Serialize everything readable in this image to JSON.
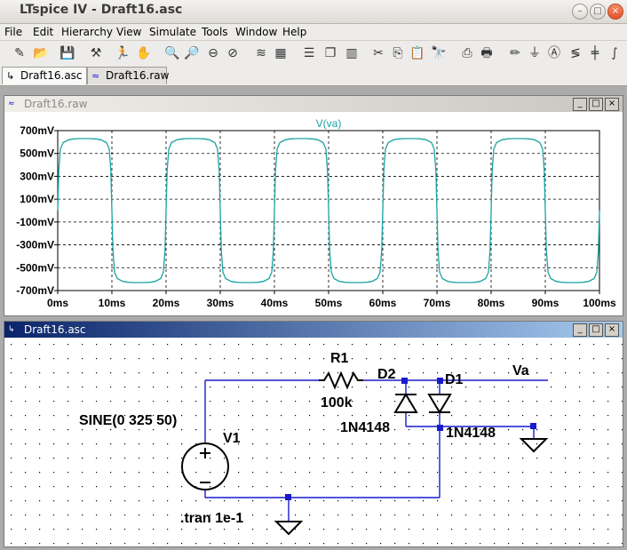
{
  "app": {
    "title": "LTspice IV - Draft16.asc",
    "window_buttons": [
      "–",
      "□",
      "×"
    ]
  },
  "menu": [
    "File",
    "Edit",
    "Hierarchy",
    "View",
    "Simulate",
    "Tools",
    "Window",
    "Help"
  ],
  "toolbar_icons": [
    "new-schematic-icon",
    "open-icon",
    "save-icon",
    "control-panel-icon",
    "run-icon",
    "halt-icon",
    "zoom-in-icon",
    "zoom-out-icon",
    "zoom-fit-icon",
    "zoom-cancel-icon",
    "autorange-icon",
    "fft-icon",
    "tile-horizontal-icon",
    "cascade-icon",
    "tile-vertical-icon",
    "cut-icon",
    "copy-icon",
    "paste-icon",
    "find-icon",
    "print-setup-icon",
    "print-icon",
    "draw-wire-icon",
    "ground-icon",
    "label-net-icon",
    "resistor-icon",
    "capacitor-icon",
    "inductor-icon"
  ],
  "tabs": [
    {
      "label": "Draft16.asc",
      "active": true
    },
    {
      "label": "Draft16.raw",
      "active": false
    }
  ],
  "waveform": {
    "window_title": "Draft16.raw",
    "window_buttons": [
      "_",
      "□",
      "×"
    ],
    "trace_color": "#1aa3a3"
  },
  "schematic": {
    "window_title": "Draft16.asc",
    "window_buttons": [
      "_",
      "□",
      "×"
    ],
    "labels": {
      "r1_name": "R1",
      "r1_value": "100k",
      "d2_name": "D2",
      "d1_name": "D1",
      "d2_model": "1N4148",
      "d1_model": "1N4148",
      "net_label": "Va",
      "v1_name": "V1",
      "v1_value": "SINE(0 325 50)",
      "directive": ".tran 1e-1"
    },
    "wire_color": "#1a1acb",
    "symbol_color": "#000000"
  },
  "chart_data": {
    "type": "line",
    "title": "V(va)",
    "xlabel": "",
    "ylabel": "",
    "x_ticks": [
      "0ms",
      "10ms",
      "20ms",
      "30ms",
      "40ms",
      "50ms",
      "60ms",
      "70ms",
      "80ms",
      "90ms",
      "100ms"
    ],
    "y_ticks": [
      "700mV",
      "500mV",
      "300mV",
      "100mV",
      "-100mV",
      "-300mV",
      "-500mV",
      "-700mV"
    ],
    "xlim": [
      0,
      100
    ],
    "ylim": [
      -700,
      700
    ],
    "grid": true,
    "series": [
      {
        "name": "V(va)",
        "x": [
          0,
          0.2,
          0.5,
          1,
          2,
          3,
          4,
          5,
          6,
          7,
          8,
          9,
          9.5,
          9.8,
          10,
          10.2,
          10.5,
          11,
          12,
          13,
          14,
          15,
          16,
          17,
          18,
          19,
          19.5,
          19.8,
          20
        ],
        "y": [
          0,
          350,
          540,
          595,
          620,
          628,
          630,
          630,
          630,
          628,
          620,
          595,
          540,
          350,
          0,
          -350,
          -540,
          -595,
          -620,
          -628,
          -630,
          -630,
          -630,
          -628,
          -620,
          -595,
          -540,
          -350,
          0
        ]
      }
    ],
    "period_ms": 20,
    "periods_shown": 5
  }
}
